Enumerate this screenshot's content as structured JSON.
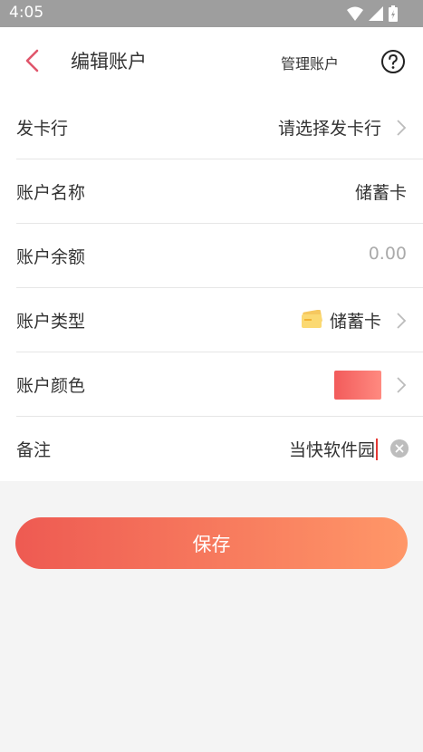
{
  "status_bar": {
    "time": "4:05"
  },
  "nav": {
    "title": "编辑账户",
    "manage_label": "管理账户"
  },
  "rows": [
    {
      "label": "发卡行",
      "value": "请选择发卡行"
    },
    {
      "label": "账户名称",
      "value": "储蓄卡"
    },
    {
      "label": "账户余额",
      "value": "0.00"
    },
    {
      "label": "账户类型",
      "value": "储蓄卡"
    },
    {
      "label": "账户颜色",
      "value": ""
    },
    {
      "label": "备注",
      "value": "当快软件园"
    }
  ],
  "save_label": "保存",
  "colors": {
    "accent": "#ee5a52",
    "swatch": "#f76b6b"
  }
}
